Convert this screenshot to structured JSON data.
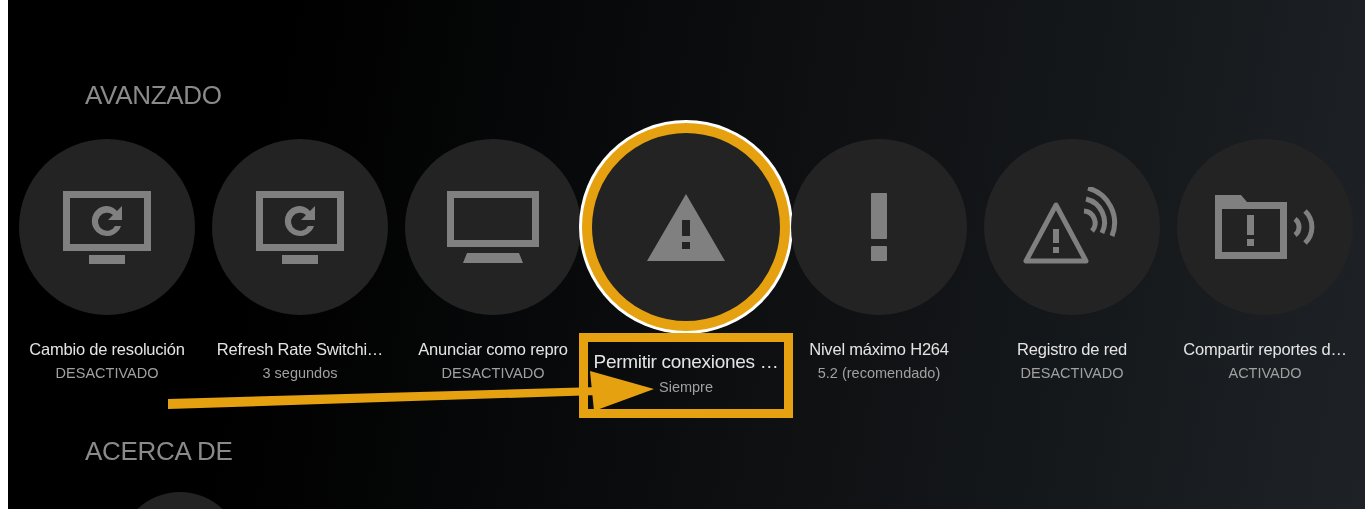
{
  "sections": [
    {
      "title": "AVANZADO",
      "items": [
        {
          "kind": "monitor-refresh",
          "title": "Cambio de resolución",
          "value": "DESACTIVADO",
          "selected": false
        },
        {
          "kind": "monitor-refresh",
          "title": "Refresh Rate Switchi…",
          "value": "3 segundos",
          "selected": false
        },
        {
          "kind": "monitor",
          "title": "Anunciar como repro",
          "value": "DESACTIVADO",
          "selected": false
        },
        {
          "kind": "warning",
          "title": "Permitir conexiones …",
          "value": "Siempre",
          "selected": true
        },
        {
          "kind": "exclamation",
          "title": "Nivel máximo H264",
          "value": "5.2 (recomendado)",
          "selected": false
        },
        {
          "kind": "warning-signal",
          "title": "Registro de red",
          "value": "DESACTIVADO",
          "selected": false
        },
        {
          "kind": "folder-signal",
          "title": "Compartir reportes d…",
          "value": "ACTIVADO",
          "selected": false
        }
      ]
    },
    {
      "title": "ACERCA DE"
    }
  ],
  "annotation": {
    "highlight_box": true,
    "arrow": true
  }
}
